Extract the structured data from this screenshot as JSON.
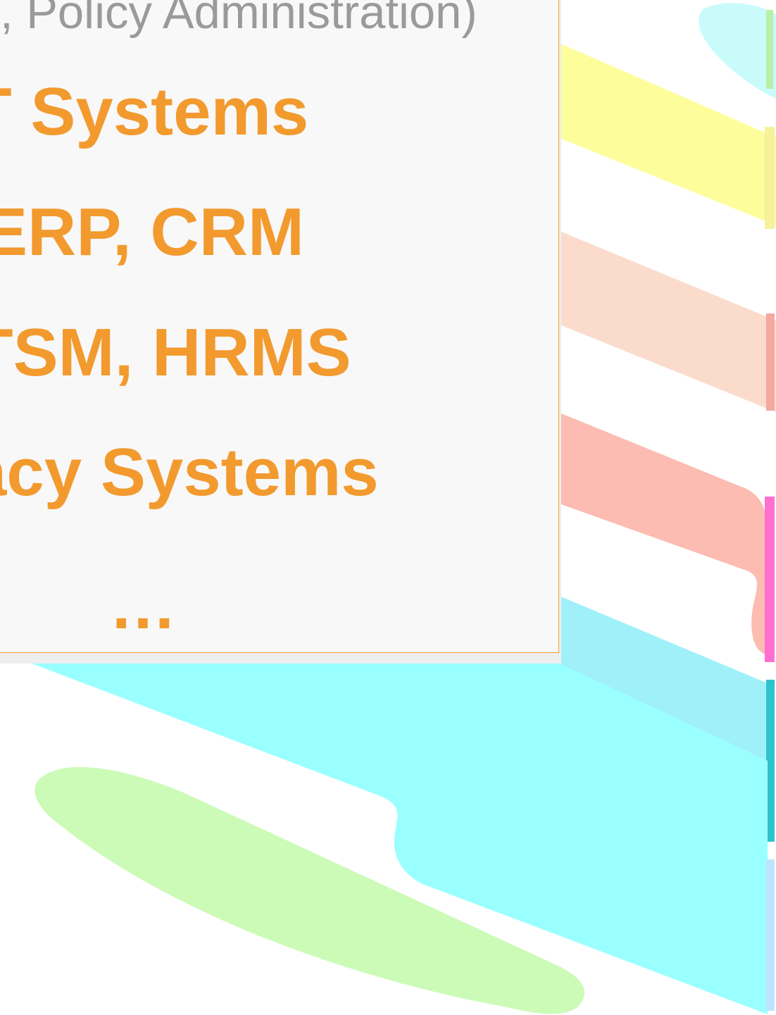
{
  "slide": {
    "subtitle": ", Policy Administration)",
    "items": [
      {
        "label": "T Systems"
      },
      {
        "label": "ERP, CRM"
      },
      {
        "label": "TSM, HRMS"
      },
      {
        "label": "acy Systems"
      },
      {
        "label": "…"
      }
    ]
  },
  "colors": {
    "accent": "#f29a2e",
    "subtitle": "#9a9a9a",
    "card_bg": "#f8f8f8",
    "stripe_yellow": "#fdfd9c",
    "stripe_peach": "#fbdccc",
    "stripe_salmon": "#fcbcb1",
    "stripe_aqua": "#99ffff",
    "stripe_sky": "#a0f0fa",
    "stripe_green": "#ccfbb8"
  }
}
